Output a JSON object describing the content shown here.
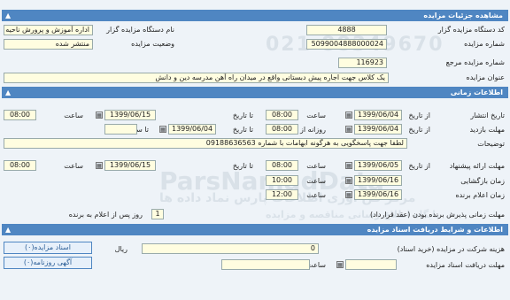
{
  "sections": {
    "details": "مشاهده جزئیات مزایده",
    "timing": "اطلاعات زمانی",
    "conditions": "اطلاعات و شرایط دریافت اسناد مزایده"
  },
  "details": {
    "org_code_label": "کد دستگاه مزایده گزار",
    "org_code": "4888",
    "org_name_label": "نام دستگاه مزایده گزار",
    "org_name": "اداره آموزش و پرورش ناحیه",
    "auction_no_label": "شماره مزایده",
    "auction_no": "5099004888000024",
    "status_label": "وضعیت مزایده",
    "status": "منتشر شده",
    "ref_no_label": "شماره مزایده مرجع",
    "ref_no": "116923",
    "title_label": "عنوان مزایده",
    "title": "یک کلاس جهت اجاره پیش دبستانی  واقع در میدان راه آهن  مدرسه دین و دانش"
  },
  "timing": {
    "from_date": "از تاریخ",
    "to_date": "تا تاریخ",
    "time": "ساعت",
    "to_time": "تا ساعت",
    "daily_from": "روزانه از ساعت",
    "publish_label": "تاریخ انتشار",
    "publish_from": "1399/06/04",
    "publish_from_time": "08:00",
    "publish_to": "1399/06/15",
    "publish_to_time": "08:00",
    "visit_label": "مهلت بازدید",
    "visit_from": "1399/06/04",
    "visit_daily_from": "08:00",
    "visit_to": "1399/06/04",
    "visit_to_time": "",
    "notes_label": "توضیحات",
    "notes": "لطفا جهت پاسخگویی به هرگونه ابهامات با شماره 09188636563",
    "offer_label": "مهلت ارائه پیشنهاد",
    "offer_from": "1399/06/05",
    "offer_from_time": "08:00",
    "offer_to": "1399/06/15",
    "offer_to_time": "08:00",
    "opening_label": "زمان بازگشایی",
    "opening_date": "1399/06/16",
    "opening_time": "10:00",
    "winner_label": "زمان اعلام برنده",
    "winner_date": "1399/06/16",
    "winner_time": "12:00",
    "validity_label": "مهلت زمانی پذیرش برنده بودن (عقد قرارداد)",
    "validity_value": "1",
    "validity_suffix": "روز پس از اعلام به برنده"
  },
  "conditions": {
    "fee_label": "هزینه شرکت در مزایده (خرید اسناد)",
    "fee_value": "0",
    "fee_unit": "ریال",
    "deadline_label": "مهلت دریافت اسناد مزایده",
    "deadline_time_label": "ساعت",
    "deadline_date": "",
    "deadline_time": "",
    "docs_button": "اسناد مزایده(۰)",
    "ad_button": "آگهی روزنامه(۰)"
  },
  "watermark": {
    "line1": "ParsNamadData",
    "line2": "مرکز فن آوری اطلاعات پارس نماد داده ها",
    "line3": "پایگاه اطلاع رسانی مناقصه و مزایده",
    "phone": "021-88349670"
  }
}
